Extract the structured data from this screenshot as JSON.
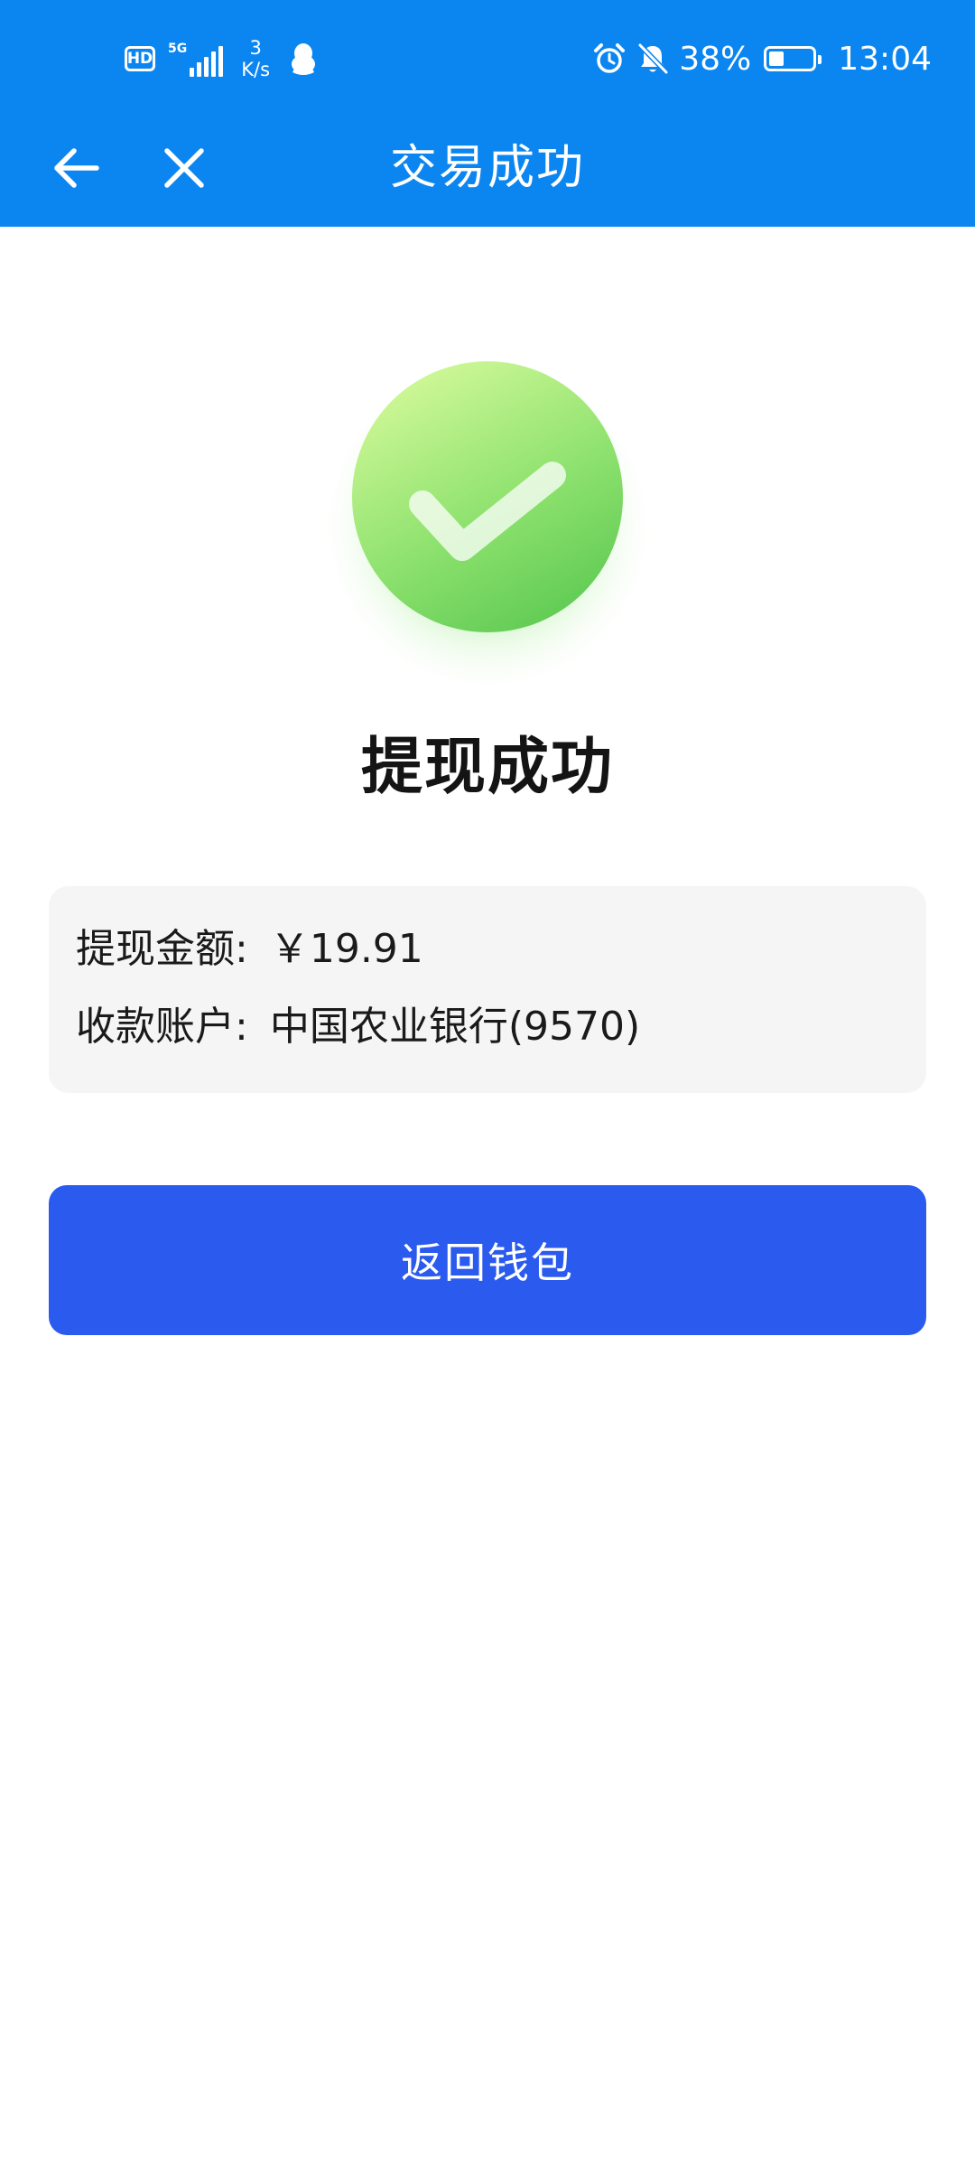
{
  "status_bar": {
    "hd": "HD",
    "network": "5G",
    "speed_value": "3",
    "speed_unit": "K/s",
    "battery": "38%",
    "time": "13:04"
  },
  "app_bar": {
    "title": "交易成功"
  },
  "result": {
    "title": "提现成功"
  },
  "details": [
    {
      "label": "提现金额:",
      "value": "￥19.91"
    },
    {
      "label": "收款账户:",
      "value": "中国农业银行(9570)"
    }
  ],
  "actions": {
    "return_label": "返回钱包"
  },
  "colors": {
    "header": "#0b86f1",
    "button": "#2a5aee",
    "card": "#f5f5f5",
    "success_green": "#6fd45e"
  },
  "icons": {
    "back": "arrow-left-icon",
    "close": "close-icon",
    "success": "check-circle-icon",
    "alarm": "alarm-icon",
    "mute": "bell-off-icon",
    "qq": "qq-penguin-icon"
  }
}
